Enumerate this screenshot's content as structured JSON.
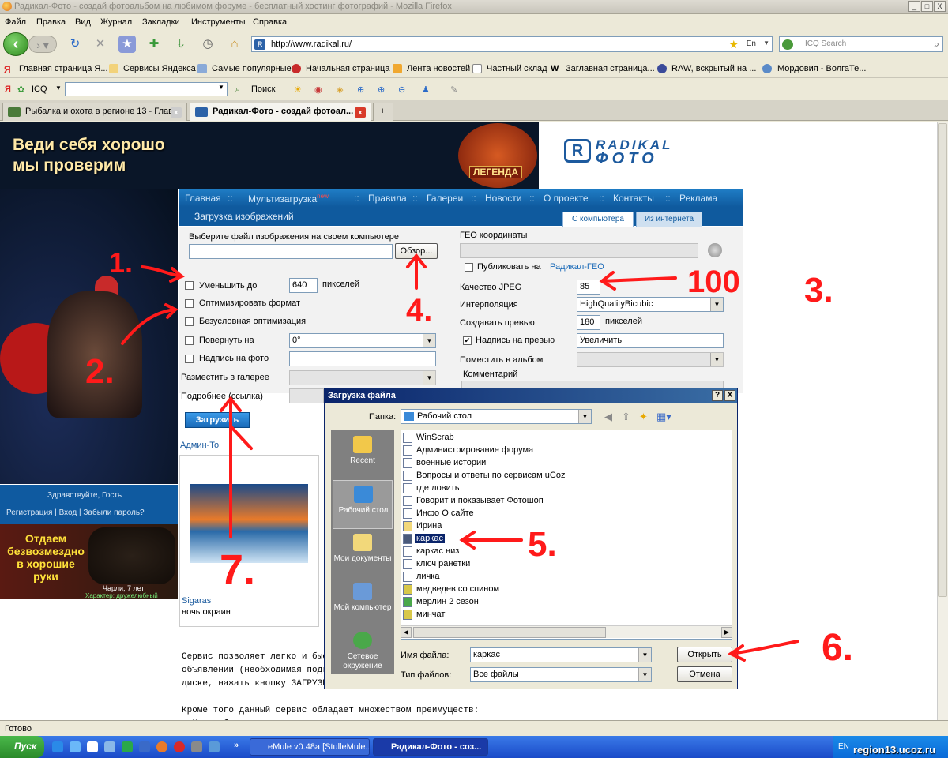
{
  "window": {
    "title": "Радикал-Фото - создай фотоальбом на любимом форуме - бесплатный хостинг фотографий - Mozilla Firefox",
    "min": "_",
    "max": "□",
    "close": "X"
  },
  "menu": [
    "Файл",
    "Правка",
    "Вид",
    "Журнал",
    "Закладки",
    "Инструменты",
    "Справка"
  ],
  "nav": {
    "url": "http://www.radikal.ru/",
    "lang": "En",
    "search_placeholder": "ICQ Search"
  },
  "bookmarks": [
    "Главная страница Я...",
    "Сервисы Яндекса",
    "Самые популярные",
    "Начальная страница",
    "Лента новостей",
    "Частный склад",
    "Заглавная страница...",
    "RAW, вскрытый на ...",
    "Мордовия - ВолгаТе..."
  ],
  "ybar": {
    "icq": "ICQ",
    "search": "Поиск"
  },
  "tabs": [
    "Рыбалка и охота в регионе 13 - Глав...",
    "Радикал-Фото - создай фотоал..."
  ],
  "ad": {
    "line1": "Веди себя хорошо",
    "line2": "мы проверим",
    "legend": "ЛЕГЕНДА"
  },
  "logo": {
    "line1": "RADIKAL",
    "line2": "ФОТО"
  },
  "sitenav": {
    "items": [
      "Главная",
      "Мультизагрузка",
      "Правила",
      "Галереи",
      "Новости",
      "О проекте",
      "Контакты",
      "Реклама"
    ],
    "new_badge": "new",
    "sep": "::"
  },
  "upload": {
    "title": "Загрузка изображений",
    "tab_pc": "С компьютера",
    "tab_web": "Из интернета"
  },
  "form": {
    "choose_label": "Выберите файл изображения на своем компьютере",
    "browse": "Обзор...",
    "reduce": "Уменьшить до",
    "reduce_val": "640",
    "pixels": "пикселей",
    "optimize": "Оптимизировать формат",
    "force_opt": "Безусловная оптимизация",
    "rotate": "Повернуть на",
    "rotate_val": "0°",
    "caption": "Надпись на фото",
    "gallery": "Разместить в галерее",
    "more": "Подробнее (ссылка)",
    "geo": "ГЕО координаты",
    "publish": "Публиковать на",
    "publish_link": "Радикал-ГЕО",
    "jpeg": "Качество JPEG",
    "jpeg_val": "85",
    "interp": "Интерполяция",
    "interp_val": "HighQualityBicubic",
    "preview": "Создавать превью",
    "preview_val": "180",
    "preview_px": "пикселей",
    "preview_cap": "Надпись на превью",
    "preview_cap_val": "Увеличить",
    "preview_cap_checked": "✔",
    "album": "Поместить в альбом",
    "comment": "Комментарий",
    "upload_btn": "Загрузить"
  },
  "left": {
    "admin": "Админ-То",
    "thumb_user": "Sigaras",
    "thumb_caption": "ночь окраин",
    "welcome": "Здравствуйте, Гость",
    "links": "Регистрация | Вход | Забыли пароль?",
    "dogad": "Отдаем безвозмездно в хорошие руки",
    "dog_name": "Чарли, 7 лет",
    "dog_char": "Характер: дружелюбный"
  },
  "desc": "Сервис позволяет легко и быст\nобъявлений (необходимая подг\nдиске, нажать кнопку ЗАГРУЗИТ\n\nКроме того данный сервис обладает множеством преимуществ:\n- Не требует регистрации",
  "dialog": {
    "title": "Загрузка файла",
    "folder_label": "Папка:",
    "folder": "Рабочий стол",
    "places": [
      "Recent",
      "Рабочий стол",
      "Мои документы",
      "Мой компьютер",
      "Сетевое окружение"
    ],
    "files": [
      "WinScrab",
      "Администрирование форума",
      "военные истории",
      "Вопросы и ответы по сервисам uCoz",
      "где ловить",
      "Говорит и показывает Фотошоп",
      "Инфо О сайте",
      "Ирина",
      "каркас",
      "каркас низ",
      "ключ ранетки",
      "личка",
      "медведев со спином",
      "мерлин 2 сезон",
      "минчат"
    ],
    "selected": "каркас",
    "filename_label": "Имя файла:",
    "filename": "каркас",
    "filetype_label": "Тип файлов:",
    "filetype": "Все файлы",
    "open": "Открыть",
    "cancel": "Отмена",
    "help": "?",
    "close": "X"
  },
  "status": "Готово",
  "taskbar": {
    "start": "Пуск",
    "items": [
      "eMule v0.48a [StulleMule...",
      "Радикал-Фото - соз..."
    ],
    "lang": "EN",
    "watermark": "region13.ucoz.ru"
  },
  "annotations": [
    "1.",
    "2.",
    "3.",
    "4.",
    "5.",
    "6.",
    "7.",
    "100"
  ],
  "colors": {
    "annotation": "#ff1a1a",
    "nav_blue": "#0f5a9e"
  }
}
